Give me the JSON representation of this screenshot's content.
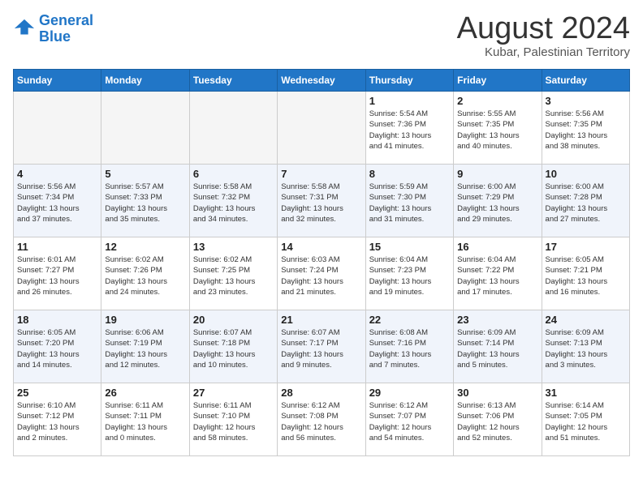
{
  "header": {
    "logo_general": "General",
    "logo_blue": "Blue",
    "month_year": "August 2024",
    "location": "Kubar, Palestinian Territory"
  },
  "weekdays": [
    "Sunday",
    "Monday",
    "Tuesday",
    "Wednesday",
    "Thursday",
    "Friday",
    "Saturday"
  ],
  "weeks": [
    [
      {
        "day": "",
        "info": ""
      },
      {
        "day": "",
        "info": ""
      },
      {
        "day": "",
        "info": ""
      },
      {
        "day": "",
        "info": ""
      },
      {
        "day": "1",
        "info": "Sunrise: 5:54 AM\nSunset: 7:36 PM\nDaylight: 13 hours\nand 41 minutes."
      },
      {
        "day": "2",
        "info": "Sunrise: 5:55 AM\nSunset: 7:35 PM\nDaylight: 13 hours\nand 40 minutes."
      },
      {
        "day": "3",
        "info": "Sunrise: 5:56 AM\nSunset: 7:35 PM\nDaylight: 13 hours\nand 38 minutes."
      }
    ],
    [
      {
        "day": "4",
        "info": "Sunrise: 5:56 AM\nSunset: 7:34 PM\nDaylight: 13 hours\nand 37 minutes."
      },
      {
        "day": "5",
        "info": "Sunrise: 5:57 AM\nSunset: 7:33 PM\nDaylight: 13 hours\nand 35 minutes."
      },
      {
        "day": "6",
        "info": "Sunrise: 5:58 AM\nSunset: 7:32 PM\nDaylight: 13 hours\nand 34 minutes."
      },
      {
        "day": "7",
        "info": "Sunrise: 5:58 AM\nSunset: 7:31 PM\nDaylight: 13 hours\nand 32 minutes."
      },
      {
        "day": "8",
        "info": "Sunrise: 5:59 AM\nSunset: 7:30 PM\nDaylight: 13 hours\nand 31 minutes."
      },
      {
        "day": "9",
        "info": "Sunrise: 6:00 AM\nSunset: 7:29 PM\nDaylight: 13 hours\nand 29 minutes."
      },
      {
        "day": "10",
        "info": "Sunrise: 6:00 AM\nSunset: 7:28 PM\nDaylight: 13 hours\nand 27 minutes."
      }
    ],
    [
      {
        "day": "11",
        "info": "Sunrise: 6:01 AM\nSunset: 7:27 PM\nDaylight: 13 hours\nand 26 minutes."
      },
      {
        "day": "12",
        "info": "Sunrise: 6:02 AM\nSunset: 7:26 PM\nDaylight: 13 hours\nand 24 minutes."
      },
      {
        "day": "13",
        "info": "Sunrise: 6:02 AM\nSunset: 7:25 PM\nDaylight: 13 hours\nand 23 minutes."
      },
      {
        "day": "14",
        "info": "Sunrise: 6:03 AM\nSunset: 7:24 PM\nDaylight: 13 hours\nand 21 minutes."
      },
      {
        "day": "15",
        "info": "Sunrise: 6:04 AM\nSunset: 7:23 PM\nDaylight: 13 hours\nand 19 minutes."
      },
      {
        "day": "16",
        "info": "Sunrise: 6:04 AM\nSunset: 7:22 PM\nDaylight: 13 hours\nand 17 minutes."
      },
      {
        "day": "17",
        "info": "Sunrise: 6:05 AM\nSunset: 7:21 PM\nDaylight: 13 hours\nand 16 minutes."
      }
    ],
    [
      {
        "day": "18",
        "info": "Sunrise: 6:05 AM\nSunset: 7:20 PM\nDaylight: 13 hours\nand 14 minutes."
      },
      {
        "day": "19",
        "info": "Sunrise: 6:06 AM\nSunset: 7:19 PM\nDaylight: 13 hours\nand 12 minutes."
      },
      {
        "day": "20",
        "info": "Sunrise: 6:07 AM\nSunset: 7:18 PM\nDaylight: 13 hours\nand 10 minutes."
      },
      {
        "day": "21",
        "info": "Sunrise: 6:07 AM\nSunset: 7:17 PM\nDaylight: 13 hours\nand 9 minutes."
      },
      {
        "day": "22",
        "info": "Sunrise: 6:08 AM\nSunset: 7:16 PM\nDaylight: 13 hours\nand 7 minutes."
      },
      {
        "day": "23",
        "info": "Sunrise: 6:09 AM\nSunset: 7:14 PM\nDaylight: 13 hours\nand 5 minutes."
      },
      {
        "day": "24",
        "info": "Sunrise: 6:09 AM\nSunset: 7:13 PM\nDaylight: 13 hours\nand 3 minutes."
      }
    ],
    [
      {
        "day": "25",
        "info": "Sunrise: 6:10 AM\nSunset: 7:12 PM\nDaylight: 13 hours\nand 2 minutes."
      },
      {
        "day": "26",
        "info": "Sunrise: 6:11 AM\nSunset: 7:11 PM\nDaylight: 13 hours\nand 0 minutes."
      },
      {
        "day": "27",
        "info": "Sunrise: 6:11 AM\nSunset: 7:10 PM\nDaylight: 12 hours\nand 58 minutes."
      },
      {
        "day": "28",
        "info": "Sunrise: 6:12 AM\nSunset: 7:08 PM\nDaylight: 12 hours\nand 56 minutes."
      },
      {
        "day": "29",
        "info": "Sunrise: 6:12 AM\nSunset: 7:07 PM\nDaylight: 12 hours\nand 54 minutes."
      },
      {
        "day": "30",
        "info": "Sunrise: 6:13 AM\nSunset: 7:06 PM\nDaylight: 12 hours\nand 52 minutes."
      },
      {
        "day": "31",
        "info": "Sunrise: 6:14 AM\nSunset: 7:05 PM\nDaylight: 12 hours\nand 51 minutes."
      }
    ]
  ]
}
